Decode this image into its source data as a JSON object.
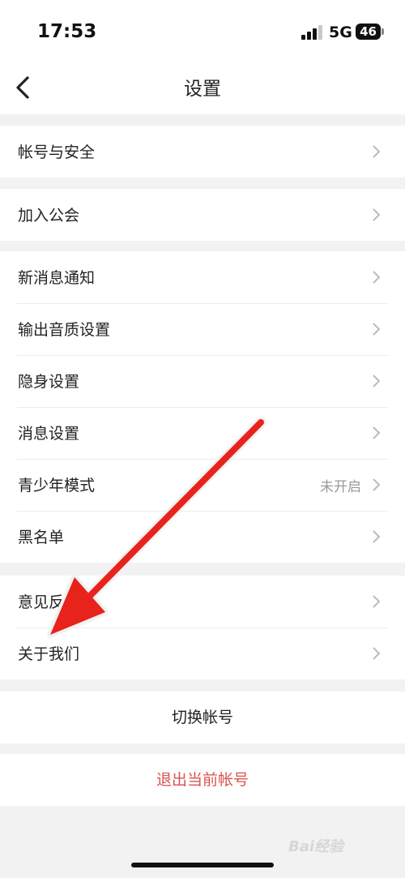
{
  "status_bar": {
    "time": "17:53",
    "network": "5G",
    "battery": "46"
  },
  "header": {
    "title": "设置",
    "back_icon": "chevron-left-icon"
  },
  "groups": [
    {
      "items": [
        {
          "label": "帐号与安全"
        }
      ]
    },
    {
      "items": [
        {
          "label": "加入公会"
        }
      ]
    },
    {
      "items": [
        {
          "label": "新消息通知"
        },
        {
          "label": "输出音质设置"
        },
        {
          "label": "隐身设置"
        },
        {
          "label": "消息设置"
        },
        {
          "label": "青少年模式",
          "value": "未开启"
        },
        {
          "label": "黑名单"
        }
      ]
    },
    {
      "items": [
        {
          "label": "意见反馈"
        },
        {
          "label": "关于我们"
        }
      ]
    }
  ],
  "actions": {
    "switch_account": "切换帐号",
    "logout": "退出当前帐号"
  },
  "colors": {
    "logout": "#d9534f",
    "arrow": "#e8231c",
    "background": "#f2f2f2"
  },
  "watermark": {
    "text": "Bai经验"
  }
}
